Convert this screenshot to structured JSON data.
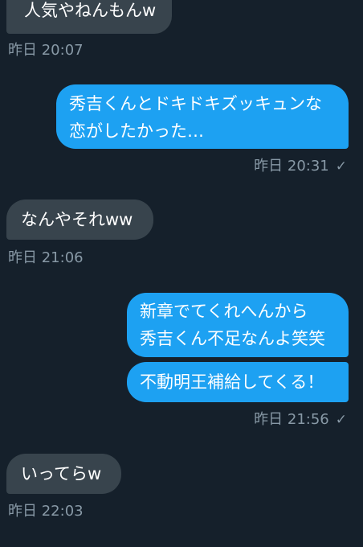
{
  "messages": [
    {
      "text": "人気やねんもんw"
    },
    {
      "text_line1": "秀吉くんとドキドキズッキュンな",
      "text_line2": "恋がしたかった…"
    },
    {
      "text": "なんやそれww"
    },
    {
      "text_line1": "新章でてくれへんから",
      "text_line2": "秀吉くん不足なんよ笑笑"
    },
    {
      "text": "不動明王補給してくる！"
    },
    {
      "text": "いってらw"
    }
  ],
  "timestamps": {
    "t1": "昨日 20:07",
    "t2": "昨日 20:31",
    "t3": "昨日 21:06",
    "t4": "昨日 21:56",
    "t5": "昨日 22:03"
  },
  "icons": {
    "sent_check": "✓"
  },
  "colors": {
    "background": "#15202b",
    "incoming_bubble": "#38444d",
    "outgoing_bubble": "#1da1f2",
    "timestamp": "#8899a6"
  }
}
